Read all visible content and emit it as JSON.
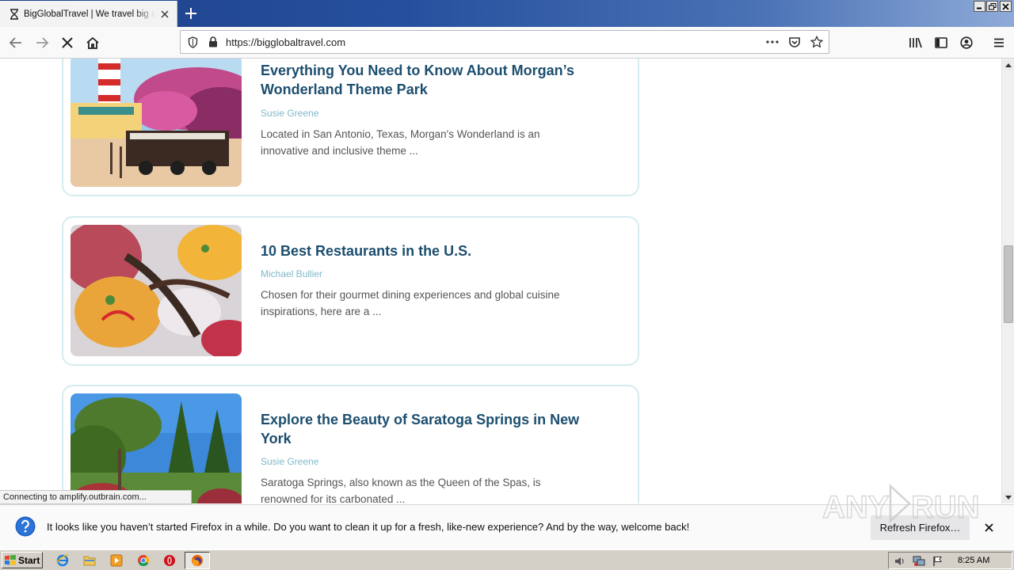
{
  "browser": {
    "tab_title": "BigGlobalTravel | We travel big and bring you the world",
    "url": "https://bigglobaltravel.com",
    "status_text": "Connecting to amplify.outbrain.com..."
  },
  "articles": [
    {
      "title_line1": "Everything You Need to Know About Morgan’s",
      "title_line2": "Wonderland Theme Park",
      "author": "Susie Greene",
      "excerpt_line1": "Located in San Antonio, Texas, Morgan's Wonderland is an",
      "excerpt_line2": "innovative and inclusive theme ..."
    },
    {
      "title_line1": "10 Best Restaurants in the U.S.",
      "author": "Michael Bullier",
      "excerpt_line1": "Chosen for their gourmet dining experiences and global cuisine",
      "excerpt_line2": "inspirations, here are a ..."
    },
    {
      "title_line1": "Explore the Beauty of Saratoga Springs in New",
      "title_line2": "York",
      "author": "Susie Greene",
      "excerpt_line1": "Saratoga Springs, also known as the Queen of the Spas, is",
      "excerpt_line2": "renowned for its carbonated ..."
    }
  ],
  "notification": {
    "message": "It looks like you haven’t started Firefox in a while. Do you want to clean it up for a fresh, like-new experience? And by the way, welcome back!",
    "button_label": "Refresh Firefox…"
  },
  "watermark": "ANY RUN",
  "taskbar": {
    "start_label": "Start",
    "clock": "8:25 AM"
  },
  "colors": {
    "article_title": "#1c4e6e",
    "author": "#7fb8c9",
    "card_border": "#d6ecef"
  }
}
